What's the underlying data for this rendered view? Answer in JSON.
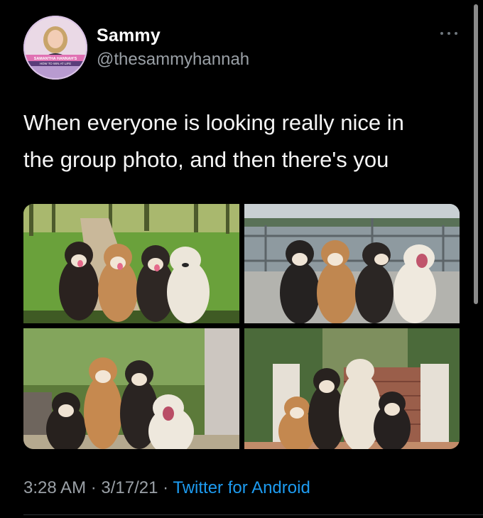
{
  "author": {
    "name": "Sammy",
    "handle": "@thesammyhannah",
    "avatar_caption_top": "SAMANTHA HANNAH'S",
    "avatar_caption_bottom": "HOW TO WIN AT LIFE"
  },
  "tweet": {
    "text": "When everyone is looking really nice in\nthe group photo, and then there's you"
  },
  "media": {
    "photos": [
      {
        "label": "four dogs on grass path"
      },
      {
        "label": "four dogs by waterfront railing"
      },
      {
        "label": "four dogs in front of trees"
      },
      {
        "label": "four dogs on steps"
      }
    ]
  },
  "meta": {
    "time": "3:28 AM",
    "date": "3/17/21",
    "separator": " · ",
    "source": "Twitter for Android"
  },
  "icons": {
    "more": "more-horizontal-icon"
  },
  "colors": {
    "background": "#000000",
    "text": "#f5f5f5",
    "secondary": "#9aa0a6",
    "link": "#1d9bf0"
  }
}
